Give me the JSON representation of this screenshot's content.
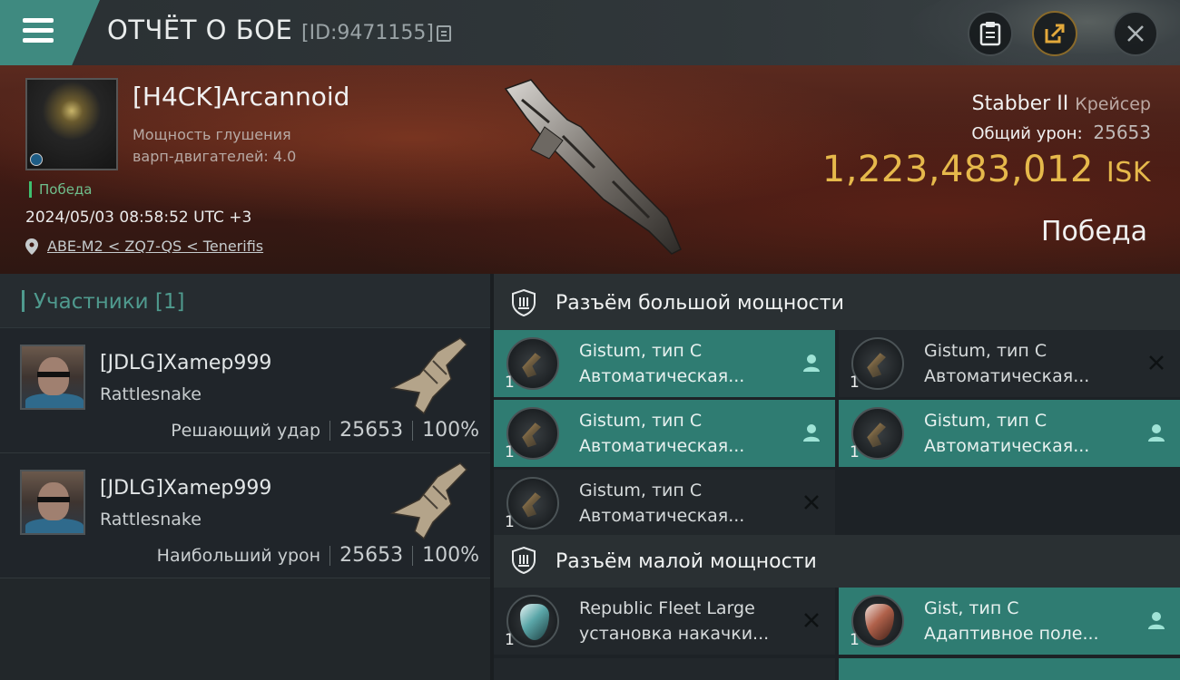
{
  "header": {
    "title": "ОТЧЁТ О БОЕ",
    "report_id": "[ID:9471155]"
  },
  "victim": {
    "name": "[H4CK]Arcannoid",
    "stat_line1": "Мощность глушения",
    "stat_line2": "варп-двигателей: 4.0",
    "victory_tag": "Победа",
    "datetime": "2024/05/03 08:58:52 UTC +3",
    "location": "ABE-M2 < ZQ7-QS < Tenerifis"
  },
  "ship": {
    "name": "Stabber II",
    "class": "Крейсер",
    "damage_label": "Общий урон:",
    "damage_value": "25653",
    "isk_value": "1,223,483,012",
    "isk_unit": "ISK",
    "result": "Победа"
  },
  "participants": {
    "header": "Участники [1]",
    "items": [
      {
        "name": "[JDLG]Xamep999",
        "ship": "Rattlesnake",
        "role": "Решающий удар",
        "damage": "25653",
        "percent": "100%"
      },
      {
        "name": "[JDLG]Xamep999",
        "ship": "Rattlesnake",
        "role": "Наибольший урон",
        "damage": "25653",
        "percent": "100%"
      }
    ]
  },
  "fitting": {
    "high_slot_title": "Разъём большой мощности",
    "high_modules": [
      {
        "qty": "1",
        "name": "Gistum, тип C",
        "type": "Автоматическая...",
        "active": true,
        "action": "person-icon"
      },
      {
        "qty": "1",
        "name": "Gistum, тип C",
        "type": "Автоматическая...",
        "active": false,
        "action": "close-icon"
      },
      {
        "qty": "1",
        "name": "Gistum, тип C",
        "type": "Автоматическая...",
        "active": true,
        "action": "person-icon"
      },
      {
        "qty": "1",
        "name": "Gistum, тип C",
        "type": "Автоматическая...",
        "active": true,
        "action": "person-icon"
      },
      {
        "qty": "1",
        "name": "Gistum, тип C",
        "type": "Автоматическая...",
        "active": false,
        "action": "close-icon"
      }
    ],
    "low_slot_title": "Разъём малой мощности",
    "low_modules": [
      {
        "qty": "1",
        "name": "Republic Fleet Large",
        "type": "установка накачки...",
        "active": false,
        "action": "close-icon"
      },
      {
        "qty": "1",
        "name": "Gist, тип C",
        "type": "Адаптивное поле...",
        "active": true,
        "action": "person-icon"
      }
    ]
  },
  "colors": {
    "accent": "#2f7c72",
    "isk": "#e6b94b",
    "victory": "#6fbf8d"
  }
}
